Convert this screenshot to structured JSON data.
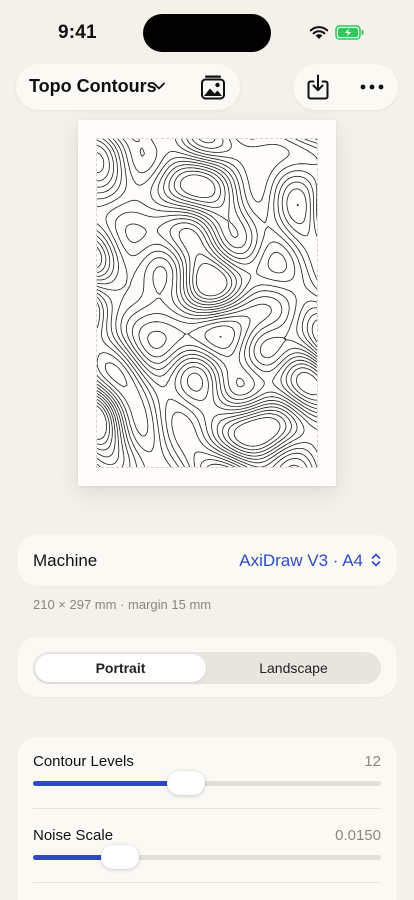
{
  "status_bar": {
    "time": "9:41"
  },
  "toolbar": {
    "project_title": "Topo Contours",
    "gallery_icon": "photo-gallery-icon",
    "download_icon": "download-icon",
    "more_icon": "ellipsis-icon"
  },
  "machine": {
    "label": "Machine",
    "value": "AxiDraw V3 · A4",
    "meta": "210 × 297 mm · margin 15 mm"
  },
  "orientation": {
    "options": [
      "Portrait",
      "Landscape"
    ],
    "selected": "Portrait"
  },
  "parameters": [
    {
      "label": "Contour Levels",
      "value": "12",
      "fraction": 0.44
    },
    {
      "label": "Noise Scale",
      "value": "0.0150",
      "fraction": 0.25
    }
  ],
  "colors": {
    "background": "#F4F1EA",
    "accent": "#2E48C6",
    "battery": "#34C759"
  }
}
